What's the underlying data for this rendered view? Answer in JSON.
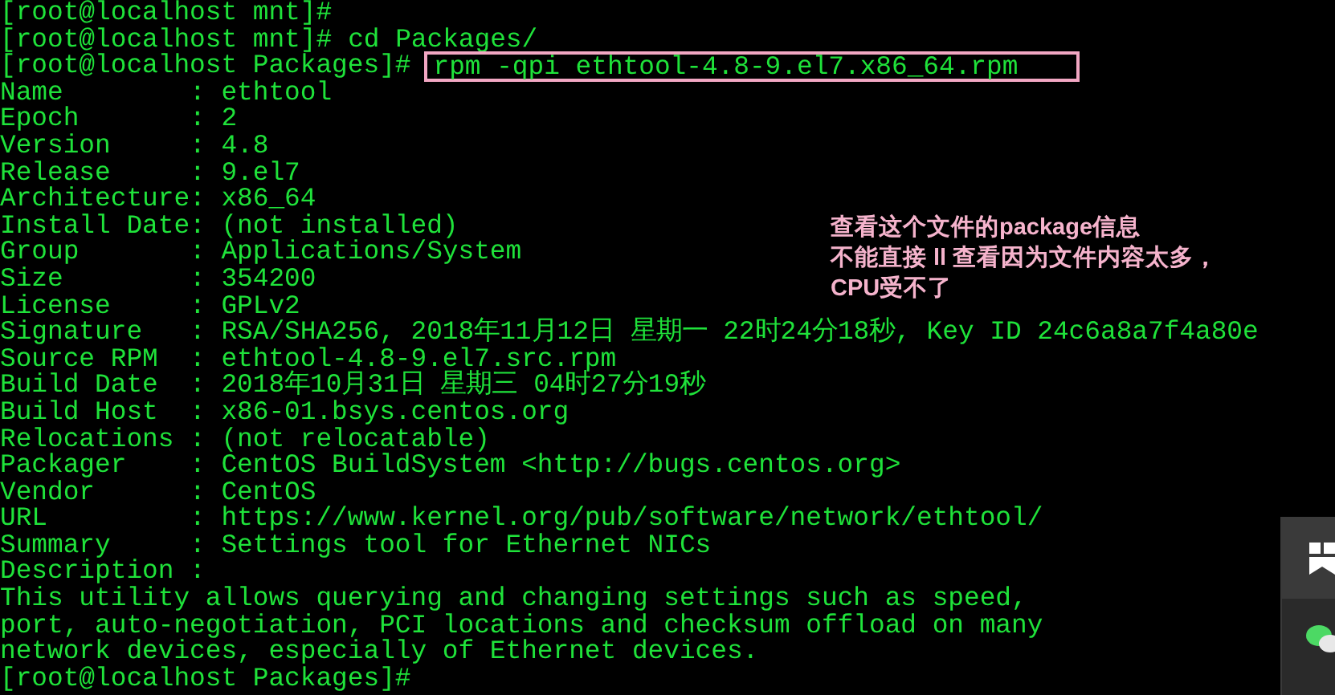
{
  "terminal": {
    "lines": [
      {
        "kind": "prompt",
        "prompt": "[root@localhost mnt]#"
      },
      {
        "kind": "prompt",
        "prompt": "[root@localhost mnt]#",
        "command": "cd Packages/"
      },
      {
        "kind": "prompt",
        "prompt": "[root@localhost Packages]#",
        "command": "rpm -qpi ethtool-4.8-9.el7.x86_64.rpm",
        "highlighted": true
      },
      {
        "kind": "output",
        "text": "Name        : ethtool"
      },
      {
        "kind": "output",
        "text": "Epoch       : 2"
      },
      {
        "kind": "output",
        "text": "Version     : 4.8"
      },
      {
        "kind": "output",
        "text": "Release     : 9.el7"
      },
      {
        "kind": "output",
        "text": "Architecture: x86_64"
      },
      {
        "kind": "output",
        "text": "Install Date: (not installed)"
      },
      {
        "kind": "output",
        "text": "Group       : Applications/System"
      },
      {
        "kind": "output",
        "text": "Size        : 354200"
      },
      {
        "kind": "output",
        "text": "License     : GPLv2"
      },
      {
        "kind": "output",
        "text": "Signature   : RSA/SHA256, 2018年11月12日 星期一 22时24分18秒, Key ID 24c6a8a7f4a80e"
      },
      {
        "kind": "output",
        "text": "Source RPM  : ethtool-4.8-9.el7.src.rpm"
      },
      {
        "kind": "output",
        "text": "Build Date  : 2018年10月31日 星期三 04时27分19秒"
      },
      {
        "kind": "output",
        "text": "Build Host  : x86-01.bsys.centos.org"
      },
      {
        "kind": "output",
        "text": "Relocations : (not relocatable)"
      },
      {
        "kind": "output",
        "text": "Packager    : CentOS BuildSystem <http://bugs.centos.org>"
      },
      {
        "kind": "output",
        "text": "Vendor      : CentOS"
      },
      {
        "kind": "output",
        "text": "URL         : https://www.kernel.org/pub/software/network/ethtool/"
      },
      {
        "kind": "output",
        "text": "Summary     : Settings tool for Ethernet NICs"
      },
      {
        "kind": "output",
        "text": "Description :"
      },
      {
        "kind": "output",
        "text": "This utility allows querying and changing settings such as speed,"
      },
      {
        "kind": "output",
        "text": "port, auto-negotiation, PCI locations and checksum offload on many"
      },
      {
        "kind": "output",
        "text": "network devices, especially of Ethernet devices."
      },
      {
        "kind": "prompt",
        "prompt": "[root@localhost Packages]#"
      }
    ]
  },
  "annotation": {
    "lines": [
      "查看这个文件的package信息",
      "不能直接 ll 查看因为文件内容太多，",
      "CPU受不了"
    ]
  }
}
